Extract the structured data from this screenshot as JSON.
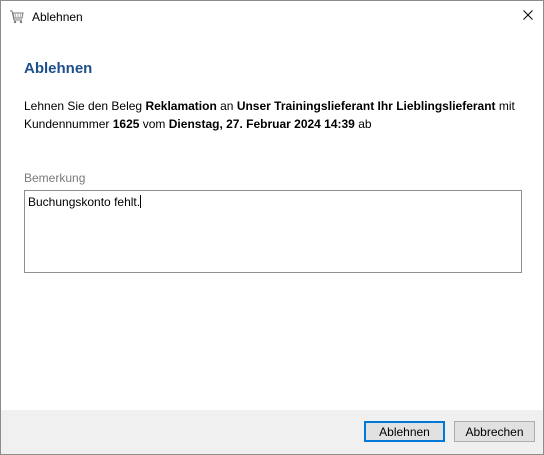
{
  "window": {
    "title": "Ablehnen",
    "close_symbol": "×"
  },
  "dialog": {
    "heading": "Ablehnen",
    "description": {
      "t1": "Lehnen Sie den Beleg ",
      "doc_type": "Reklamation",
      "t2": " an ",
      "recipient": "Unser Trainingslieferant Ihr Lieblingslieferant",
      "t3": " mit Kundennummer ",
      "customer_number": "1625",
      "t4": " vom ",
      "date": "Dienstag, 27. Februar 2024 14:39",
      "t5": " ab"
    },
    "remark_label": "Bemerkung",
    "remark_value": "Buchungskonto fehlt."
  },
  "buttons": {
    "reject": "Ablehnen",
    "cancel": "Abbrechen"
  },
  "icons": {
    "app": "cart-icon",
    "close": "close-icon"
  }
}
